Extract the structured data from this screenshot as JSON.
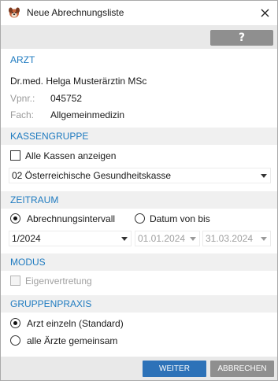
{
  "window": {
    "title": "Neue Abrechnungsliste",
    "close_glyph": "✕",
    "help_label": "?"
  },
  "colors": {
    "accent": "#1f7bc0",
    "primary_button": "#2d72b8",
    "secondary_button": "#8f8f8f",
    "section_bg": "#f0f0f0"
  },
  "arzt": {
    "heading": "ARZT",
    "name": "Dr.med. Helga Musterärztin MSc",
    "vpnr_label": "Vpnr.:",
    "vpnr_value": "045752",
    "fach_label": "Fach:",
    "fach_value": "Allgemeinmedizin"
  },
  "kassengruppe": {
    "heading": "KASSENGRUPPE",
    "checkbox_label": "Alle Kassen anzeigen",
    "checkbox_checked": false,
    "selected_value": "02 Österreichische Gesundheitskasse"
  },
  "zeitraum": {
    "heading": "ZEITRAUM",
    "radio1_label": "Abrechnungsintervall",
    "radio2_label": "Datum von bis",
    "selected_radio": "Abrechnungsintervall",
    "interval_value": "1/2024",
    "from_date": "01.01.2024",
    "to_date": "31.03.2024"
  },
  "modus": {
    "heading": "MODUS",
    "checkbox_label": "Eigenvertretung",
    "checkbox_checked": false,
    "disabled": true
  },
  "gruppenpraxis": {
    "heading": "GRUPPENPRAXIS",
    "radio1_label": "Arzt einzeln (Standard)",
    "radio2_label": "alle Ärzte gemeinsam",
    "selected_radio": "Arzt einzeln (Standard)"
  },
  "footer": {
    "next_label": "WEITER",
    "cancel_label": "ABBRECHEN"
  },
  "icons": {
    "app": "dog-head-icon",
    "close": "close-icon",
    "help": "help-icon",
    "dropdown": "chevron-down-icon"
  }
}
